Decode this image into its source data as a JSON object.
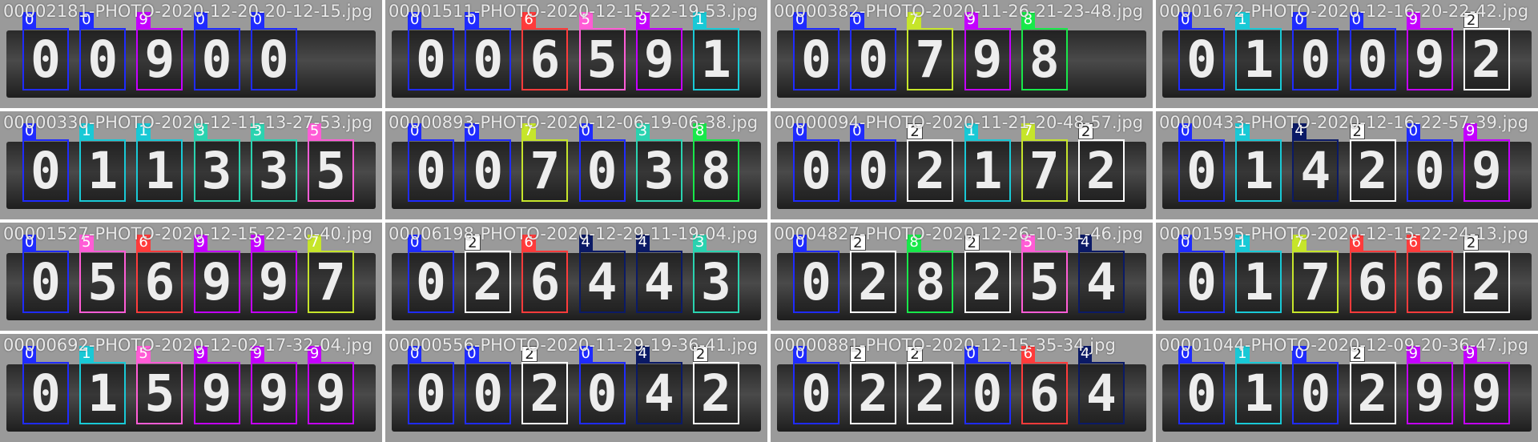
{
  "class_colors": {
    "0": "#1f2bff",
    "1": "#19c9d6",
    "2": "#ffffff",
    "3": "#2ad3b0",
    "4": "#0b1a66",
    "5": "#ff5cd6",
    "6": "#ff3b3b",
    "7": "#c6e52a",
    "8": "#18e84a",
    "9": "#c400ff"
  },
  "tiles": [
    {
      "filename": "00002181-PHOTO-2020-12-20-20-12-15.jpg",
      "detections": [
        "0",
        "0",
        "9",
        "0",
        "0"
      ]
    },
    {
      "filename": "00001511-PHOTO-2020-12-15-22-19-53.jpg",
      "detections": [
        "0",
        "0",
        "6",
        "5",
        "9",
        "1"
      ]
    },
    {
      "filename": "00000382-PHOTO-2020-11-26-21-23-48.jpg",
      "detections": [
        "0",
        "0",
        "7",
        "9",
        "8"
      ]
    },
    {
      "filename": "00001672-PHOTO-2020-12-16-20-22-42.jpg",
      "detections": [
        "0",
        "1",
        "0",
        "0",
        "9",
        "2"
      ]
    },
    {
      "filename": "00000330-PHOTO-2020-12-11-13-27-53.jpg",
      "detections": [
        "0",
        "1",
        "1",
        "3",
        "3",
        "5"
      ]
    },
    {
      "filename": "00000893-PHOTO-2020-12-06-19-06-38.jpg",
      "detections": [
        "0",
        "0",
        "7",
        "0",
        "3",
        "8"
      ]
    },
    {
      "filename": "00000094-PHOTO-2020-11-21-20-48-57.jpg",
      "detections": [
        "0",
        "0",
        "2",
        "1",
        "7",
        "2"
      ]
    },
    {
      "filename": "00000433-PHOTO-2020-12-16-22-57-39.jpg",
      "detections": [
        "0",
        "1",
        "4",
        "2",
        "0",
        "9"
      ]
    },
    {
      "filename": "00001527-PHOTO-2020-12-15-22-20-40.jpg",
      "detections": [
        "0",
        "5",
        "6",
        "9",
        "9",
        "7"
      ]
    },
    {
      "filename": "00006198-PHOTO-2020-12-29-11-19-04.jpg",
      "detections": [
        "0",
        "2",
        "6",
        "4",
        "4",
        "3"
      ]
    },
    {
      "filename": "00004827-PHOTO-2020-12-26-10-31-46.jpg",
      "detections": [
        "0",
        "2",
        "8",
        "2",
        "5",
        "4"
      ]
    },
    {
      "filename": "00001595-PHOTO-2020-12-15-22-24-13.jpg",
      "detections": [
        "0",
        "1",
        "7",
        "6",
        "6",
        "2"
      ]
    },
    {
      "filename": "00000692-PHOTO-2020-12-02-17-32-04.jpg",
      "detections": [
        "0",
        "1",
        "5",
        "9",
        "9",
        "9"
      ]
    },
    {
      "filename": "00000556-PHOTO-2020-11-29-19-36-41.jpg",
      "detections": [
        "0",
        "0",
        "2",
        "0",
        "4",
        "2"
      ]
    },
    {
      "filename": "00000881-PHOTO-2020-12-15-35-34.jpg",
      "detections": [
        "0",
        "2",
        "2",
        "0",
        "6",
        "4"
      ]
    },
    {
      "filename": "00001044-PHOTO-2020-12-09-20-36-47.jpg",
      "detections": [
        "0",
        "1",
        "0",
        "2",
        "9",
        "9"
      ]
    }
  ]
}
